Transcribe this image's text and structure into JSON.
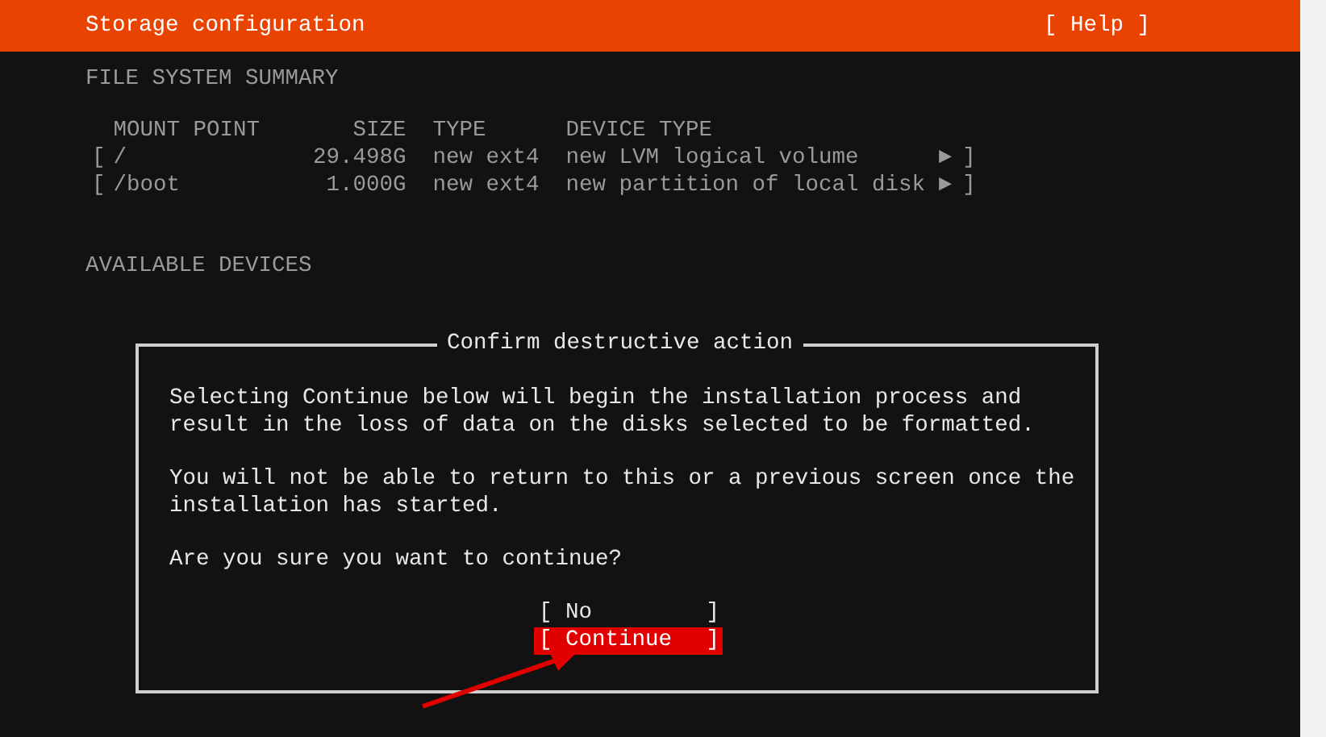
{
  "header": {
    "title": "Storage configuration",
    "help": "[ Help ]"
  },
  "filesystem_summary": {
    "heading": "FILE SYSTEM SUMMARY",
    "columns": [
      "MOUNT POINT",
      "SIZE",
      "TYPE",
      "DEVICE TYPE"
    ],
    "rows": [
      {
        "open": "[",
        "mount_point": "/",
        "size": "29.498G",
        "type": "new ext4",
        "device_type": "new LVM logical volume",
        "arrow": "►",
        "close": "]"
      },
      {
        "open": "[",
        "mount_point": "/boot",
        "size": "1.000G",
        "type": "new ext4",
        "device_type": "new partition of local disk",
        "arrow": "►",
        "close": "]"
      }
    ]
  },
  "available_devices": {
    "heading": "AVAILABLE DEVICES"
  },
  "dialog": {
    "title": "Confirm destructive action",
    "paragraphs": [
      "Selecting Continue below will begin the installation process and result in the loss of data on the disks selected to be formatted.",
      "You will not be able to return to this or a previous screen once the installation has started.",
      "Are you sure you want to continue?"
    ],
    "buttons": [
      {
        "open": "[",
        "label": "No",
        "close": "]",
        "selected": false
      },
      {
        "open": "[",
        "label": "Continue",
        "close": "]",
        "selected": true
      }
    ]
  }
}
